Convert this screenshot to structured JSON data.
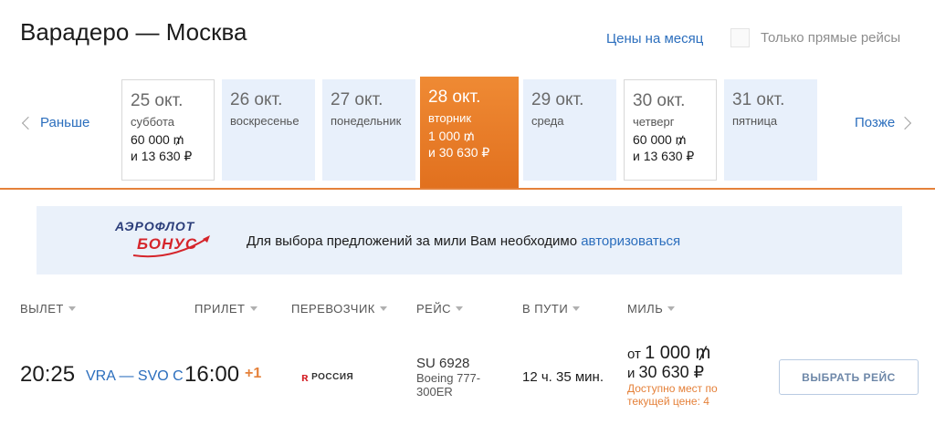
{
  "header": {
    "title": "Варадеро — Москва",
    "prices_link": "Цены на месяц",
    "direct_only_label": "Только прямые рейсы"
  },
  "date_nav": {
    "prev_label": "Раньше",
    "next_label": "Позже",
    "dates": [
      {
        "day": "25 окт.",
        "weekday": "суббота",
        "miles": "60 000 ₥",
        "rub": "и 13 630 ₽",
        "state": "white"
      },
      {
        "day": "26 окт.",
        "weekday": "воскресенье",
        "miles": "",
        "rub": "",
        "state": "blue"
      },
      {
        "day": "27 окт.",
        "weekday": "понедельник",
        "miles": "",
        "rub": "",
        "state": "blue"
      },
      {
        "day": "28 окт.",
        "weekday": "вторник",
        "miles": "1 000 ₥",
        "rub": "и 30 630 ₽",
        "state": "active"
      },
      {
        "day": "29 окт.",
        "weekday": "среда",
        "miles": "",
        "rub": "",
        "state": "blue"
      },
      {
        "day": "30 окт.",
        "weekday": "четверг",
        "miles": "60 000 ₥",
        "rub": "и 13 630 ₽",
        "state": "white"
      },
      {
        "day": "31 окт.",
        "weekday": "пятница",
        "miles": "",
        "rub": "",
        "state": "blue"
      }
    ]
  },
  "banner": {
    "logo_brand": "АЭРОФЛОТ",
    "logo_bonus": "БОНУС",
    "text": "Для выбора предложений за мили Вам необходимо ",
    "link": "авторизоваться"
  },
  "columns": {
    "departure": "ВЫЛЕТ",
    "arrival": "ПРИЛЕТ",
    "carrier": "ПЕРЕВОЗЧИК",
    "flight": "РЕЙС",
    "duration": "В ПУТИ",
    "miles": "МИЛЬ"
  },
  "flight": {
    "dep_time": "20:25",
    "route": "VRA — SVO C",
    "arr_time": "16:00",
    "plus_day": "+1",
    "carrier_name": "РОССИЯ",
    "flight_no": "SU 6928",
    "aircraft": "Boeing 777-300ER",
    "duration": "12 ч. 35 мин.",
    "miles_prefix": "от ",
    "miles_value": "1 000 ₥",
    "rub_prefix": "и ",
    "rub_value": "30 630 ₽",
    "seats_note": "Доступно мест по текущей цене: 4",
    "select_label": "ВЫБРАТЬ РЕЙС"
  },
  "colors": {
    "accent_orange": "#e5813a",
    "link_blue": "#2b6ebd",
    "card_blue": "#e8f0fb"
  }
}
